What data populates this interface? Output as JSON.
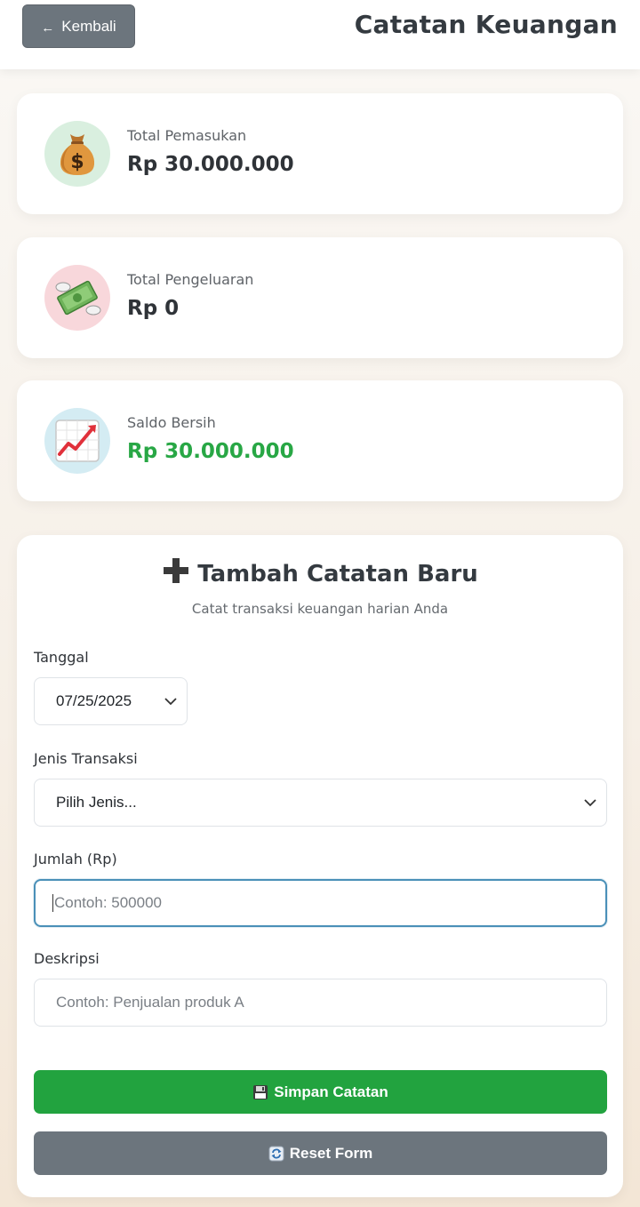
{
  "header": {
    "back_label": "Kembali",
    "title": "Catatan Keuangan"
  },
  "summary": {
    "income": {
      "label": "Total Pemasukan",
      "value": "Rp 30.000.000",
      "icon": "money-bag-icon",
      "bg": "#d9efdf"
    },
    "expense": {
      "label": "Total Pengeluaran",
      "value": "Rp 0",
      "icon": "money-with-wings-icon",
      "bg": "#f8d7db"
    },
    "balance": {
      "label": "Saldo Bersih",
      "value": "Rp 30.000.000",
      "icon": "chart-increasing-icon",
      "bg": "#d4ecf3",
      "color": "#28a745"
    }
  },
  "form": {
    "title": "Tambah Catatan Baru",
    "subtitle": "Catat transaksi keuangan harian Anda",
    "date": {
      "label": "Tanggal",
      "value": "07/25/2025"
    },
    "type": {
      "label": "Jenis Transaksi",
      "value": "Pilih Jenis..."
    },
    "amount": {
      "label": "Jumlah (Rp)",
      "placeholder": "Contoh: 500000"
    },
    "description": {
      "label": "Deskripsi",
      "placeholder": "Contoh: Penjualan produk A"
    },
    "save_label": "Simpan Catatan",
    "reset_label": "Reset Form"
  },
  "colors": {
    "accent_green": "#22a33f",
    "secondary_gray": "#6c757d",
    "focus_blue": "#4a90b8"
  }
}
